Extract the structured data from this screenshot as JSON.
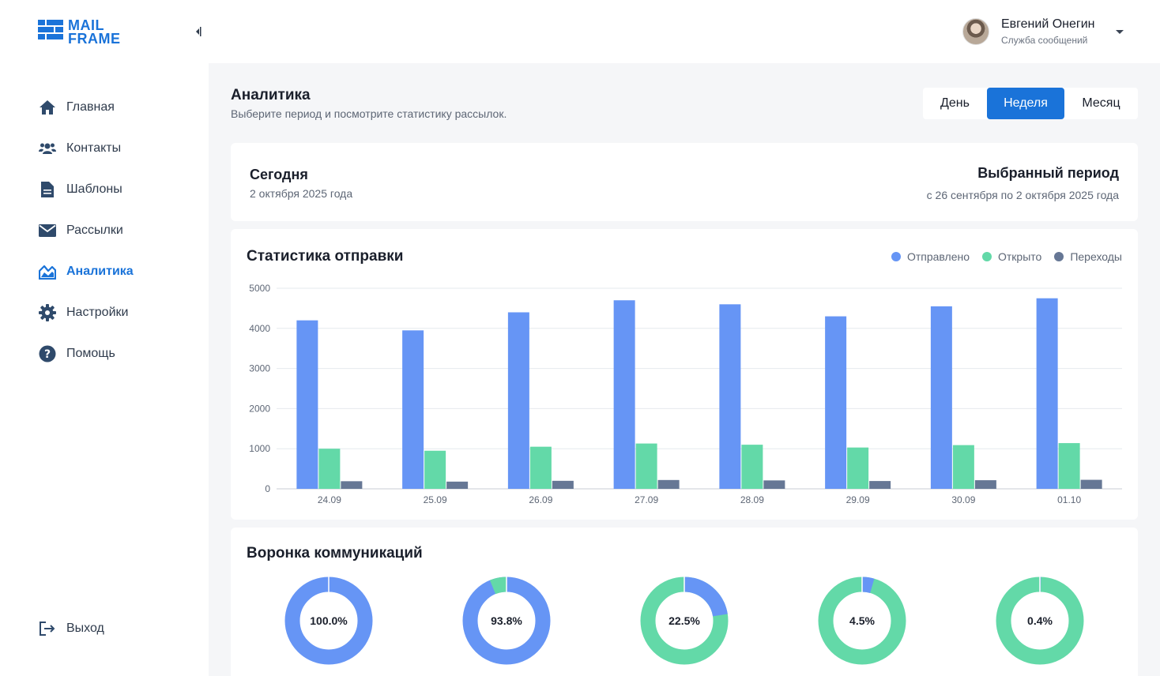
{
  "brand": {
    "line1": "MAIL",
    "line2": "FRAME",
    "color": "#1a73d9"
  },
  "sidebar": {
    "items": [
      {
        "label": "Главная",
        "icon": "home-icon"
      },
      {
        "label": "Контакты",
        "icon": "users-icon"
      },
      {
        "label": "Шаблоны",
        "icon": "document-icon"
      },
      {
        "label": "Рассылки",
        "icon": "envelope-icon"
      },
      {
        "label": "Аналитика",
        "icon": "chart-area-icon",
        "active": true
      },
      {
        "label": "Настройки",
        "icon": "gear-icon"
      },
      {
        "label": "Помощь",
        "icon": "question-icon"
      }
    ],
    "logout": "Выход"
  },
  "user": {
    "name": "Евгений Онегин",
    "role": "Служба сообщений"
  },
  "page": {
    "title": "Аналитика",
    "subtitle": "Выберите период и посмотрите статистику рассылок."
  },
  "period": {
    "options": [
      "День",
      "Неделя",
      "Месяц"
    ],
    "selected": "Неделя"
  },
  "dates": {
    "today_title": "Сегодня",
    "today_value": "2 октября 2025 года",
    "period_title": "Выбранный период",
    "period_value": "с 26 сентября по 2 октября 2025 года"
  },
  "stats": {
    "title": "Статистика отправки"
  },
  "chart_data": {
    "type": "bar",
    "title": "Статистика отправки",
    "categories": [
      "24.09",
      "25.09",
      "26.09",
      "27.09",
      "28.09",
      "29.09",
      "30.09",
      "01.10"
    ],
    "series": [
      {
        "name": "Отправлено",
        "color": "#6695f5",
        "values": [
          4200,
          3950,
          4400,
          4700,
          4600,
          4300,
          4550,
          4750
        ]
      },
      {
        "name": "Открыто",
        "color": "#63d9a8",
        "values": [
          1000,
          950,
          1050,
          1130,
          1100,
          1030,
          1090,
          1140
        ]
      },
      {
        "name": "Переходы",
        "color": "#667795",
        "values": [
          190,
          180,
          200,
          220,
          210,
          195,
          215,
          225
        ]
      }
    ],
    "ylim": [
      0,
      5000
    ],
    "yticks": [
      0,
      1000,
      2000,
      3000,
      4000,
      5000
    ],
    "grid": true,
    "legend": "top-right"
  },
  "funnel": {
    "title": "Воронка коммуникаций",
    "items": [
      {
        "label": "100.0%",
        "value": 100.0
      },
      {
        "label": "93.8%",
        "value": 93.8
      },
      {
        "label": "22.5%",
        "value": 22.5
      },
      {
        "label": "4.5%",
        "value": 4.5
      },
      {
        "label": "0.4%",
        "value": 0.4
      }
    ],
    "colors": {
      "primary": "#6695f5",
      "secondary": "#63d9a8"
    }
  }
}
